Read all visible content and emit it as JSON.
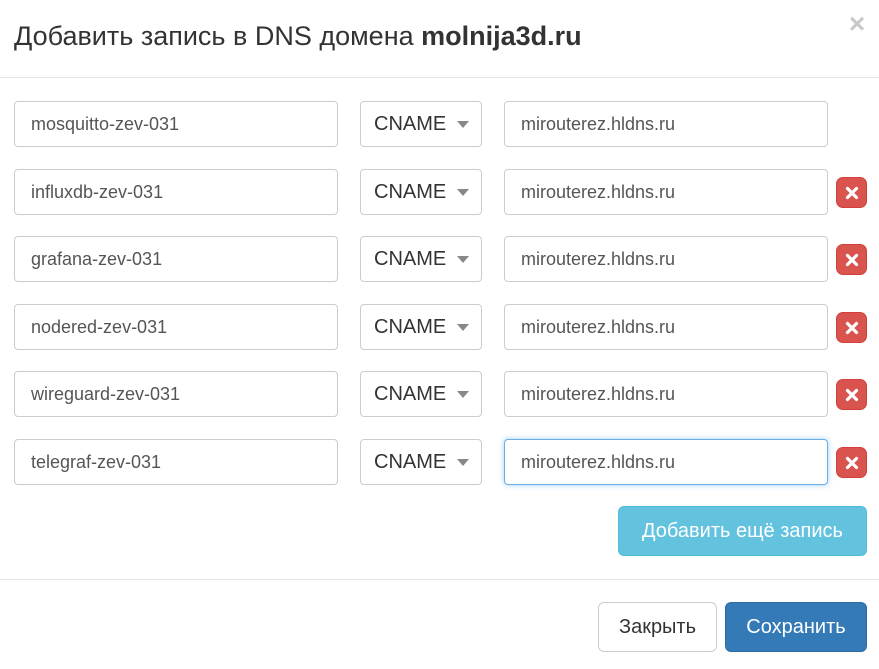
{
  "header": {
    "title_prefix": "Добавить запись в DNS домена ",
    "domain": "molnija3d.ru",
    "close_icon": "close-icon"
  },
  "records": [
    {
      "name": "mosquitto-zev-031",
      "type": "CNAME",
      "value": "mirouterez.hldns.ru",
      "deletable": false
    },
    {
      "name": "influxdb-zev-031",
      "type": "CNAME",
      "value": "mirouterez.hldns.ru",
      "deletable": true
    },
    {
      "name": "grafana-zev-031",
      "type": "CNAME",
      "value": "mirouterez.hldns.ru",
      "deletable": true
    },
    {
      "name": "nodered-zev-031",
      "type": "CNAME",
      "value": "mirouterez.hldns.ru",
      "deletable": true
    },
    {
      "name": "wireguard-zev-031",
      "type": "CNAME",
      "value": "mirouterez.hldns.ru",
      "deletable": true
    },
    {
      "name": "telegraf-zev-031",
      "type": "CNAME",
      "value": "mirouterez.hldns.ru",
      "deletable": true,
      "focused_field": "value"
    }
  ],
  "actions": {
    "add_record_label": "Добавить ещё запись"
  },
  "footer": {
    "close_label": "Закрыть",
    "save_label": "Сохранить"
  },
  "colors": {
    "danger": "#d9534f",
    "info": "#5bc0de",
    "primary": "#337ab7",
    "focus": "#66afe9"
  }
}
